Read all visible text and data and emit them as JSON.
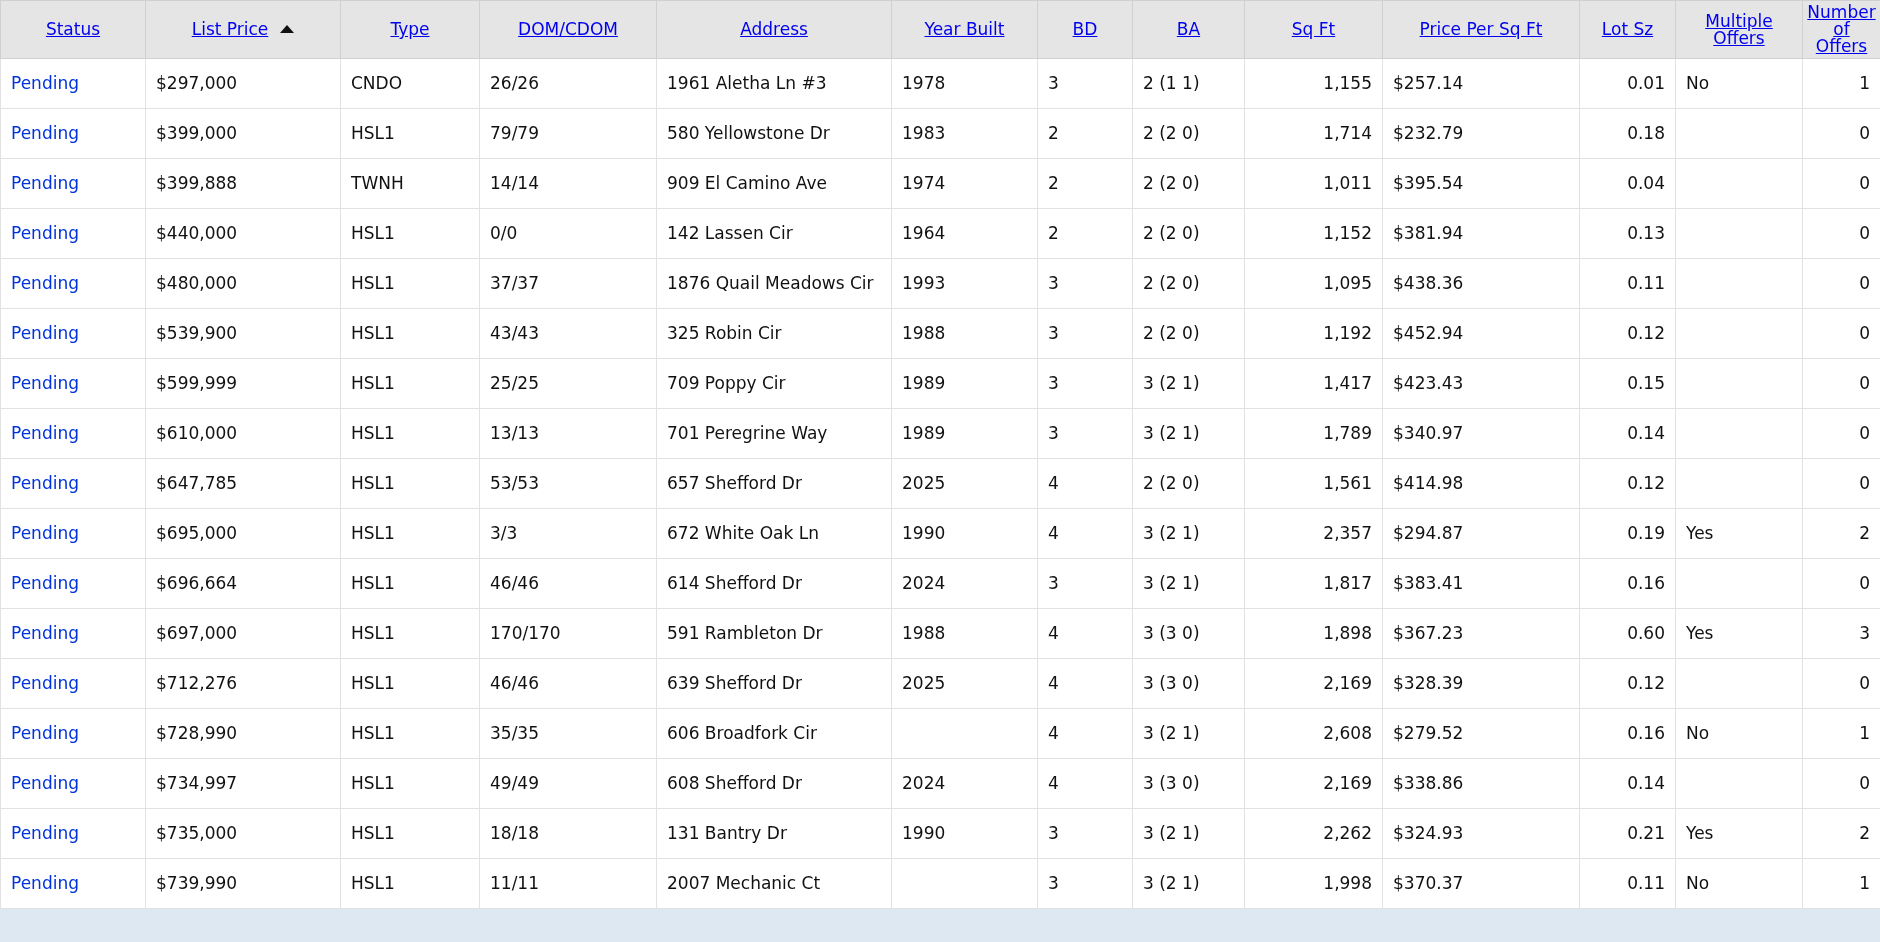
{
  "table": {
    "columns": [
      {
        "label": "Status",
        "kind": "text",
        "sorted": false
      },
      {
        "label": "List Price",
        "kind": "text",
        "sorted": true
      },
      {
        "label": "Type",
        "kind": "text",
        "sorted": false
      },
      {
        "label": "DOM/CDOM",
        "kind": "text",
        "sorted": false
      },
      {
        "label": "Address",
        "kind": "text",
        "sorted": false
      },
      {
        "label": "Year Built",
        "kind": "text",
        "sorted": false
      },
      {
        "label": "BD",
        "kind": "text",
        "sorted": false
      },
      {
        "label": "BA",
        "kind": "text",
        "sorted": false
      },
      {
        "label": "Sq Ft",
        "kind": "number",
        "sorted": false
      },
      {
        "label": "Price Per Sq Ft",
        "kind": "text",
        "sorted": false
      },
      {
        "label": "Lot Sz",
        "kind": "number",
        "sorted": false
      },
      {
        "label": "Multiple Offers",
        "kind": "text",
        "sorted": false
      },
      {
        "label": "Number of Offers",
        "kind": "number",
        "sorted": false
      }
    ],
    "rows": [
      [
        "Pending",
        "$297,000",
        "CNDO",
        "26/26",
        "1961 Aletha Ln #3",
        "1978",
        "3",
        "2 (1 1)",
        "1,155",
        "$257.14",
        "0.01",
        "No",
        "1"
      ],
      [
        "Pending",
        "$399,000",
        "HSL1",
        "79/79",
        "580 Yellowstone Dr",
        "1983",
        "2",
        "2 (2 0)",
        "1,714",
        "$232.79",
        "0.18",
        "",
        "0"
      ],
      [
        "Pending",
        "$399,888",
        "TWNH",
        "14/14",
        "909 El Camino Ave",
        "1974",
        "2",
        "2 (2 0)",
        "1,011",
        "$395.54",
        "0.04",
        "",
        "0"
      ],
      [
        "Pending",
        "$440,000",
        "HSL1",
        "0/0",
        "142 Lassen Cir",
        "1964",
        "2",
        "2 (2 0)",
        "1,152",
        "$381.94",
        "0.13",
        "",
        "0"
      ],
      [
        "Pending",
        "$480,000",
        "HSL1",
        "37/37",
        "1876 Quail Meadows Cir",
        "1993",
        "3",
        "2 (2 0)",
        "1,095",
        "$438.36",
        "0.11",
        "",
        "0"
      ],
      [
        "Pending",
        "$539,900",
        "HSL1",
        "43/43",
        "325 Robin Cir",
        "1988",
        "3",
        "2 (2 0)",
        "1,192",
        "$452.94",
        "0.12",
        "",
        "0"
      ],
      [
        "Pending",
        "$599,999",
        "HSL1",
        "25/25",
        "709 Poppy Cir",
        "1989",
        "3",
        "3 (2 1)",
        "1,417",
        "$423.43",
        "0.15",
        "",
        "0"
      ],
      [
        "Pending",
        "$610,000",
        "HSL1",
        "13/13",
        "701 Peregrine Way",
        "1989",
        "3",
        "3 (2 1)",
        "1,789",
        "$340.97",
        "0.14",
        "",
        "0"
      ],
      [
        "Pending",
        "$647,785",
        "HSL1",
        "53/53",
        "657 Shefford Dr",
        "2025",
        "4",
        "2 (2 0)",
        "1,561",
        "$414.98",
        "0.12",
        "",
        "0"
      ],
      [
        "Pending",
        "$695,000",
        "HSL1",
        "3/3",
        "672 White Oak Ln",
        "1990",
        "4",
        "3 (2 1)",
        "2,357",
        "$294.87",
        "0.19",
        "Yes",
        "2"
      ],
      [
        "Pending",
        "$696,664",
        "HSL1",
        "46/46",
        "614 Shefford Dr",
        "2024",
        "3",
        "3 (2 1)",
        "1,817",
        "$383.41",
        "0.16",
        "",
        "0"
      ],
      [
        "Pending",
        "$697,000",
        "HSL1",
        "170/170",
        "591 Rambleton Dr",
        "1988",
        "4",
        "3 (3 0)",
        "1,898",
        "$367.23",
        "0.60",
        "Yes",
        "3"
      ],
      [
        "Pending",
        "$712,276",
        "HSL1",
        "46/46",
        "639 Shefford Dr",
        "2025",
        "4",
        "3 (3 0)",
        "2,169",
        "$328.39",
        "0.12",
        "",
        "0"
      ],
      [
        "Pending",
        "$728,990",
        "HSL1",
        "35/35",
        "606 Broadfork Cir",
        "",
        "4",
        "3 (2 1)",
        "2,608",
        "$279.52",
        "0.16",
        "No",
        "1"
      ],
      [
        "Pending",
        "$734,997",
        "HSL1",
        "49/49",
        "608 Shefford Dr",
        "2024",
        "4",
        "3 (3 0)",
        "2,169",
        "$338.86",
        "0.14",
        "",
        "0"
      ],
      [
        "Pending",
        "$735,000",
        "HSL1",
        "18/18",
        "131 Bantry Dr",
        "1990",
        "3",
        "3 (2 1)",
        "2,262",
        "$324.93",
        "0.21",
        "Yes",
        "2"
      ],
      [
        "Pending",
        "$739,990",
        "HSL1",
        "11/11",
        "2007 Mechanic Ct",
        "",
        "3",
        "3 (2 1)",
        "1,998",
        "$370.37",
        "0.11",
        "No",
        "1"
      ]
    ]
  }
}
